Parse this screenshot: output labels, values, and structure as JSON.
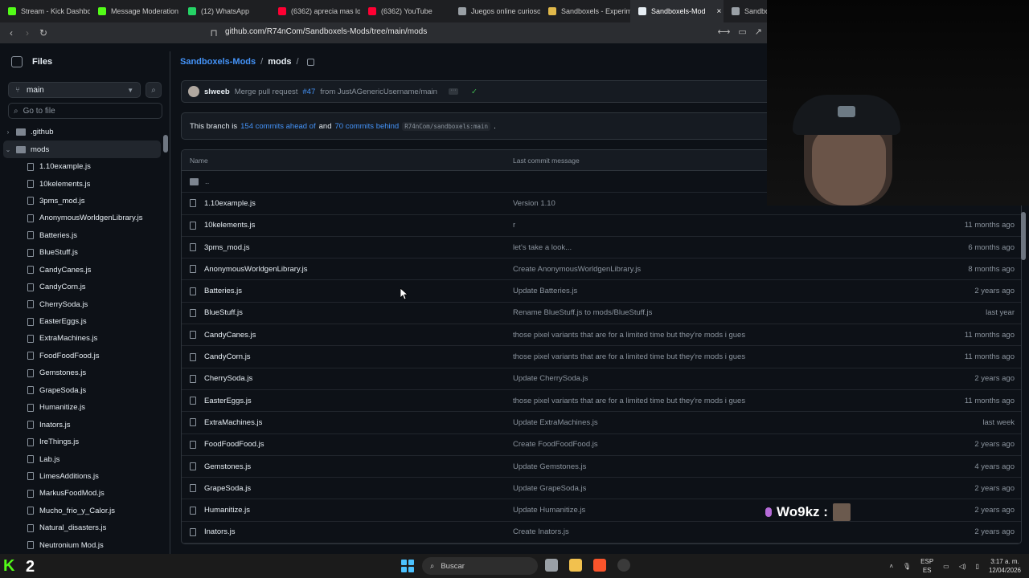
{
  "browser": {
    "tabs": [
      {
        "label": "Stream - Kick Dashbo",
        "color": "#53fc18"
      },
      {
        "label": "Message Moderation",
        "color": "#53fc18"
      },
      {
        "label": "(12) WhatsApp",
        "color": "#25d366"
      },
      {
        "label": "(6362) aprecia mas lo",
        "color": "#ff0033"
      },
      {
        "label": "(6362) YouTube",
        "color": "#ff0033"
      },
      {
        "label": "Juegos online curioso",
        "color": "#9aa0a6"
      },
      {
        "label": "Sandboxels - Experim",
        "color": "#e0b84a"
      },
      {
        "label": "Sandboxels-Mod",
        "color": "#e6edf3",
        "active": true
      },
      {
        "label": "Sandbox",
        "color": "#9aa0a6"
      }
    ],
    "url": "github.com/R74nCom/Sandboxels-Mods/tree/main/mods"
  },
  "sidebar": {
    "title": "Files",
    "branch": "main",
    "goto_placeholder": "Go to file",
    "tree": [
      {
        "label": ".github",
        "type": "folder",
        "expanded": false
      },
      {
        "label": "mods",
        "type": "folder",
        "expanded": true,
        "selected": true
      },
      {
        "label": "1.10example.js",
        "type": "file"
      },
      {
        "label": "10kelements.js",
        "type": "file"
      },
      {
        "label": "3pms_mod.js",
        "type": "file"
      },
      {
        "label": "AnonymousWorldgenLibrary.js",
        "type": "file"
      },
      {
        "label": "Batteries.js",
        "type": "file"
      },
      {
        "label": "BlueStuff.js",
        "type": "file"
      },
      {
        "label": "CandyCanes.js",
        "type": "file"
      },
      {
        "label": "CandyCorn.js",
        "type": "file"
      },
      {
        "label": "CherrySoda.js",
        "type": "file"
      },
      {
        "label": "EasterEggs.js",
        "type": "file"
      },
      {
        "label": "ExtraMachines.js",
        "type": "file"
      },
      {
        "label": "FoodFoodFood.js",
        "type": "file"
      },
      {
        "label": "Gemstones.js",
        "type": "file"
      },
      {
        "label": "GrapeSoda.js",
        "type": "file"
      },
      {
        "label": "Humanitize.js",
        "type": "file"
      },
      {
        "label": "Inators.js",
        "type": "file"
      },
      {
        "label": "IreThings.js",
        "type": "file"
      },
      {
        "label": "Lab.js",
        "type": "file"
      },
      {
        "label": "LimesAdditions.js",
        "type": "file"
      },
      {
        "label": "MarkusFoodMod.js",
        "type": "file"
      },
      {
        "label": "Mucho_frio_y_Calor.js",
        "type": "file"
      },
      {
        "label": "Natural_disasters.js",
        "type": "file"
      },
      {
        "label": "Neutronium Mod.js",
        "type": "file"
      }
    ]
  },
  "breadcrumb": {
    "repo": "Sandboxels-Mods",
    "sep": "/",
    "current": "mods",
    "trail": "/"
  },
  "commit": {
    "user": "slweeb",
    "message_prefix": "Merge pull request",
    "pr": "#47",
    "message_suffix": "from JustAGenericUsername/main",
    "dots": "···",
    "check": "✓"
  },
  "ahead": {
    "prefix": "This branch is",
    "ahead_link": "154 commits ahead of",
    "and": "and",
    "behind_link": "70 commits behind",
    "ref": "R74nCom/sandboxels:main",
    "suffix": "."
  },
  "table": {
    "header_name": "Name",
    "header_message": "Last commit message",
    "parent": "..",
    "rows": [
      {
        "name": "1.10example.js",
        "message": "Version 1.10",
        "date": ""
      },
      {
        "name": "10kelements.js",
        "message": "r",
        "date": "11 months ago"
      },
      {
        "name": "3pms_mod.js",
        "message": "let's take a look...",
        "date": "6 months ago"
      },
      {
        "name": "AnonymousWorldgenLibrary.js",
        "message": "Create AnonymousWorldgenLibrary.js",
        "date": "8 months ago"
      },
      {
        "name": "Batteries.js",
        "message": "Update Batteries.js",
        "date": "2 years ago"
      },
      {
        "name": "BlueStuff.js",
        "message": "Rename BlueStuff.js to mods/BlueStuff.js",
        "date": "last year"
      },
      {
        "name": "CandyCanes.js",
        "message": "those pixel variants that are for a limited time but they're mods i gues",
        "date": "11 months ago"
      },
      {
        "name": "CandyCorn.js",
        "message": "those pixel variants that are for a limited time but they're mods i gues",
        "date": "11 months ago"
      },
      {
        "name": "CherrySoda.js",
        "message": "Update CherrySoda.js",
        "date": "2 years ago"
      },
      {
        "name": "EasterEggs.js",
        "message": "those pixel variants that are for a limited time but they're mods i gues",
        "date": "11 months ago"
      },
      {
        "name": "ExtraMachines.js",
        "message": "Update ExtraMachines.js",
        "date": "last week"
      },
      {
        "name": "FoodFoodFood.js",
        "message": "Create FoodFoodFood.js",
        "date": "2 years ago"
      },
      {
        "name": "Gemstones.js",
        "message": "Update Gemstones.js",
        "date": "4 years ago"
      },
      {
        "name": "GrapeSoda.js",
        "message": "Update GrapeSoda.js",
        "date": "2 years ago"
      },
      {
        "name": "Humanitize.js",
        "message": "Update Humanitize.js",
        "date": "2 years ago"
      },
      {
        "name": "Inators.js",
        "message": "Create Inators.js",
        "date": "2 years ago"
      }
    ]
  },
  "overlay": {
    "name": "Wo9kz :"
  },
  "taskbar": {
    "kick_logo": "K",
    "kick_count": "2",
    "search": "Buscar",
    "lang_top": "ESP",
    "lang_bottom": "ES",
    "time": "3:17 a. m.",
    "date": "12/04/2026"
  },
  "colors": {
    "accent": "#4493f8",
    "bg": "#0d1117",
    "border": "#30363d",
    "success": "#3fb950"
  }
}
